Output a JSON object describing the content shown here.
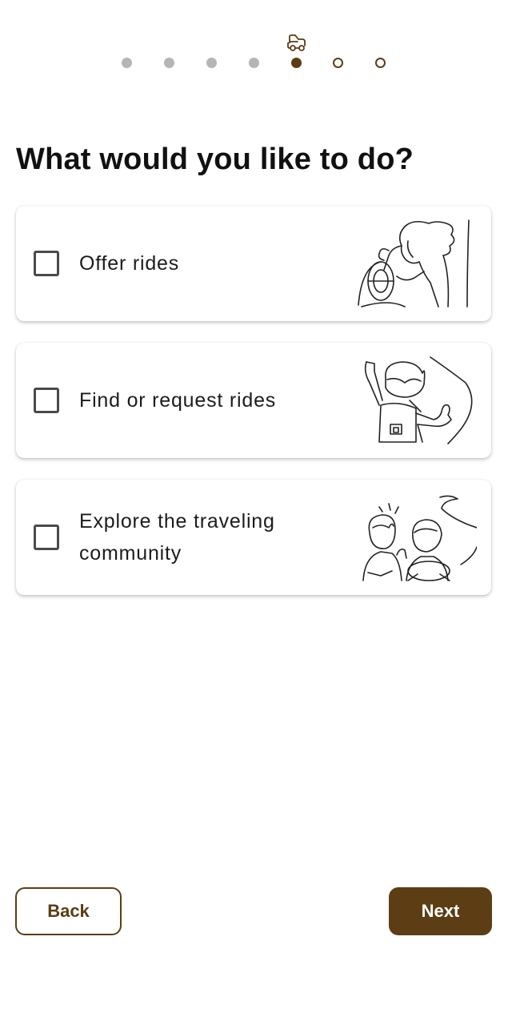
{
  "progress": {
    "steps": [
      "done",
      "done",
      "done",
      "done",
      "current",
      "todo",
      "todo"
    ],
    "current_step_icon": "car-icon"
  },
  "title": "What would you like to do?",
  "options": [
    {
      "label": "Offer rides",
      "checked": false,
      "illustration": "driver-steering-wheel-illustration"
    },
    {
      "label": "Find or request rides",
      "checked": false,
      "illustration": "hitchhiker-backpack-illustration"
    },
    {
      "label": "Explore the traveling community",
      "checked": false,
      "illustration": "friends-traveling-illustration"
    }
  ],
  "buttons": {
    "back_label": "Back",
    "next_label": "Next"
  },
  "colors": {
    "accent": "#5c3d14",
    "dot_inactive": "#b5b5b5",
    "checkbox_border": "#4a4a4a"
  }
}
